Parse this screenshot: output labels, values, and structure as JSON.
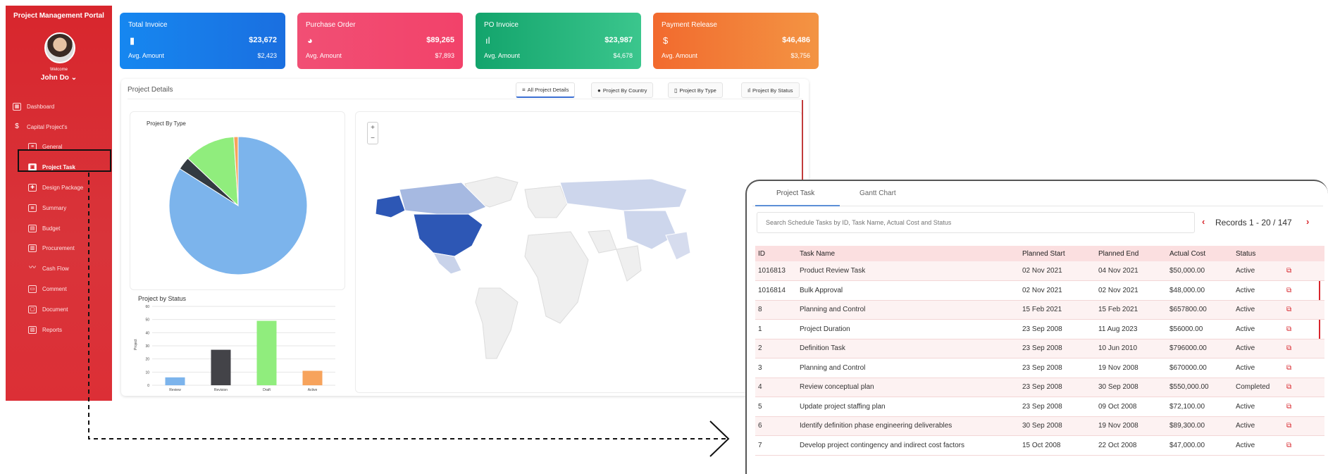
{
  "sidebar": {
    "app_title": "Project Management Portal",
    "welcome": "Welcome",
    "username": "John Do",
    "items": [
      {
        "label": "Dashboard",
        "icon": "grid-icon"
      },
      {
        "label": "Capital Project's",
        "icon": "dollar-icon"
      },
      {
        "label": "General",
        "icon": "list-icon"
      },
      {
        "label": "Project Task",
        "icon": "task-icon"
      },
      {
        "label": "Design Package",
        "icon": "puzzle-icon"
      },
      {
        "label": "Summary",
        "icon": "summary-icon"
      },
      {
        "label": "Budget",
        "icon": "budget-icon"
      },
      {
        "label": "Procurement",
        "icon": "procurement-icon"
      },
      {
        "label": "Cash Flow",
        "icon": "trend-icon"
      },
      {
        "label": "Comment",
        "icon": "comment-icon"
      },
      {
        "label": "Document",
        "icon": "document-icon"
      },
      {
        "label": "Reports",
        "icon": "reports-icon"
      }
    ]
  },
  "kpis": [
    {
      "title": "Total Invoice",
      "value": "$23,672",
      "sub_label": "Avg. Amount",
      "sub_value": "$2,423",
      "icon": "file-icon",
      "color_from": "#1687f0",
      "color_to": "#1a6fe0"
    },
    {
      "title": "Purchase Order",
      "value": "$89,265",
      "sub_label": "Avg. Amount",
      "sub_value": "$7,893",
      "icon": "pie-icon",
      "color_from": "#f14f74",
      "color_to": "#f2426a"
    },
    {
      "title": "PO Invoice",
      "value": "$23,987",
      "sub_label": "Avg. Amount",
      "sub_value": "$4,678",
      "icon": "bar-icon",
      "color_from": "#13a46c",
      "color_to": "#3bc68d"
    },
    {
      "title": "Payment Release",
      "value": "$46,486",
      "sub_label": "Avg. Amount",
      "sub_value": "$3,756",
      "icon": "dollar-icon",
      "color_from": "#f26a2e",
      "color_to": "#f39443"
    }
  ],
  "details": {
    "title": "Project Details",
    "tabs": [
      {
        "label": "All Project Details",
        "icon": "list-icon"
      },
      {
        "label": "Project By Country",
        "icon": "pin-icon"
      },
      {
        "label": "Project By Type",
        "icon": "bookmark-icon"
      },
      {
        "label": "Project By Status",
        "icon": "bar-icon"
      }
    ],
    "pie_title": "Project By Type",
    "bar_title": "Project by Status",
    "map_zoom_in": "+",
    "map_zoom_out": "−"
  },
  "chart_data": [
    {
      "type": "pie",
      "title": "Project By Type",
      "slices": [
        {
          "value": 84,
          "color": "#7cb4ec"
        },
        {
          "value": 3,
          "color": "#333a41"
        },
        {
          "value": 12,
          "color": "#90ed7d"
        },
        {
          "value": 1,
          "color": "#f7a35c"
        }
      ]
    },
    {
      "type": "bar",
      "title": "Project by Status",
      "ylabel": "Project",
      "categories": [
        "Review",
        "Revision",
        "Draft",
        "Active"
      ],
      "values": [
        6,
        27,
        49,
        11
      ],
      "colors": [
        "#7cb4ec",
        "#434348",
        "#90ed7d",
        "#f7a35c"
      ],
      "ylim": [
        0,
        60
      ],
      "yticks": [
        0,
        10,
        20,
        30,
        40,
        50,
        60
      ],
      "grid": true
    }
  ],
  "popup": {
    "tabs": [
      "Project Task",
      "Gantt Chart"
    ],
    "search_placeholder": "Search Schedule Tasks by ID, Task Name, Actual Cost and Status",
    "records": "Records  1 - 20 / 147",
    "prev": "‹",
    "next": "›",
    "columns": [
      "ID",
      "Task Name",
      "Planned Start",
      "Planned End",
      "Actual Cost",
      "Status",
      ""
    ],
    "rows": [
      [
        "1016813",
        "Product Review Task",
        "02 Nov 2021",
        "04 Nov 2021",
        "$50,000.00",
        "Active"
      ],
      [
        "1016814",
        "Bulk Approval",
        "02 Nov 2021",
        "02 Nov 2021",
        "$48,000.00",
        "Active"
      ],
      [
        "8",
        "Planning and Control",
        "15 Feb 2021",
        "15 Feb 2021",
        "$657800.00",
        "Active"
      ],
      [
        "1",
        "Project Duration",
        "23 Sep 2008",
        "11 Aug 2023",
        "$56000.00",
        "Active"
      ],
      [
        "2",
        "Definition Task",
        "23 Sep 2008",
        "10 Jun 2010",
        "$796000.00",
        "Active"
      ],
      [
        "3",
        "Planning and Control",
        "23 Sep 2008",
        "19 Nov 2008",
        "$670000.00",
        "Active"
      ],
      [
        "4",
        "Review conceptual plan",
        "23 Sep 2008",
        "30 Sep 2008",
        "$550,000.00",
        "Completed"
      ],
      [
        "5",
        "Update project staffing plan",
        "23 Sep 2008",
        "09 Oct 2008",
        "$72,100.00",
        "Active"
      ],
      [
        "6",
        "Identify definition phase engineering deliverables",
        "30 Sep 2008",
        "19 Nov 2008",
        "$89,300.00",
        "Active"
      ],
      [
        "7",
        "Develop project contingency and indirect cost factors",
        "15 Oct 2008",
        "22 Oct 2008",
        "$47,000.00",
        "Active"
      ]
    ]
  }
}
